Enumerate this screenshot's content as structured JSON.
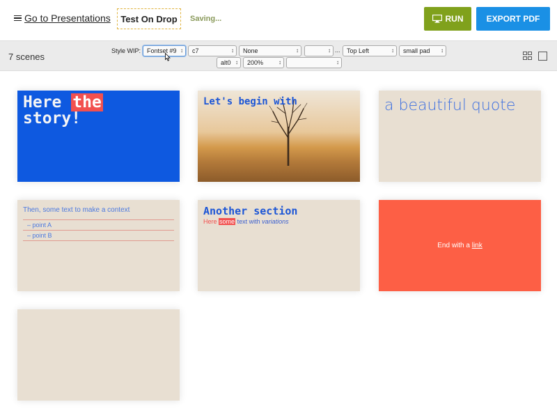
{
  "header": {
    "back_link": "Go to Presentations",
    "presentation_title": "Test On Drop",
    "save_status": "Saving...",
    "run_label": "RUN",
    "export_label": "EXPORT PDF"
  },
  "toolbar": {
    "scene_count": "7 scenes",
    "style_label": "Style WIP:",
    "selects": {
      "fontset": "Fontset #9",
      "color": "c7",
      "none": "None",
      "blank1": "",
      "position": "Top Left",
      "padding": "small pad",
      "alt": "alt0",
      "zoom": "200%",
      "blank2": ""
    },
    "ellipsis": "..."
  },
  "scenes": [
    {
      "line1_pre": "Here ",
      "line1_highlight": "the",
      "line2": "story!"
    },
    {
      "title": "Let's begin with"
    },
    {
      "title": "a beautiful quote"
    },
    {
      "intro": "Then, some text to make a context",
      "points": [
        "– point A",
        "– point B"
      ]
    },
    {
      "title": "Another section",
      "sub_here": "Here",
      "sub_some": "some",
      "sub_text": "text with",
      "sub_variations": "variations"
    },
    {
      "text_pre": "End with a ",
      "link": "link"
    },
    {}
  ],
  "colors": {
    "run_green": "#80a11c",
    "export_blue": "#1a90e5",
    "scene_blue": "#0e59e0",
    "scene_beige": "#e8dfd2",
    "scene_red": "#fd5f45",
    "highlight_red": "#f2504f"
  }
}
